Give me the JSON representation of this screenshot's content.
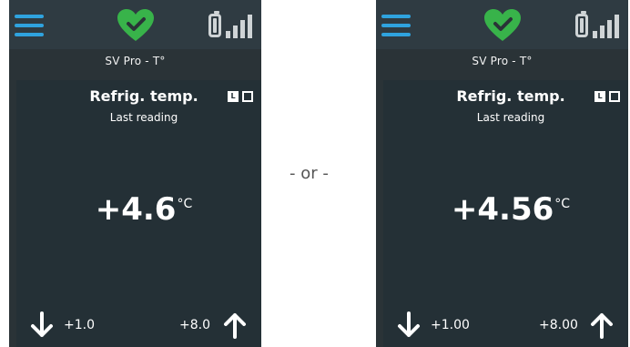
{
  "colors": {
    "background": "#ffffff",
    "device_background": "#2a3337",
    "topbar": "#2f3b42",
    "menu_blue": "#2fa3df",
    "heart_green": "#38b34a",
    "heart_check": "#2a3337",
    "icon_gray": "#cfd4d6",
    "text": "#ffffff"
  },
  "separator": "- or -",
  "devices": [
    {
      "device_name": "SV Pro - T°",
      "measure_title": "Refrig. temp.",
      "measure_subtitle": "Last reading",
      "lh_toggle_label": "L",
      "reading_value": "+4.6",
      "reading_unit": "°C",
      "low_limit": "+1.0",
      "high_limit": "+8.0",
      "icons": [
        "menu-icon",
        "heart-check-icon",
        "battery-icon",
        "signal-icon",
        "arrow-down-icon",
        "arrow-up-icon"
      ]
    },
    {
      "device_name": "SV Pro - T°",
      "measure_title": "Refrig. temp.",
      "measure_subtitle": "Last reading",
      "lh_toggle_label": "L",
      "reading_value": "+4.56",
      "reading_unit": "°C",
      "low_limit": "+1.00",
      "high_limit": "+8.00",
      "icons": [
        "menu-icon",
        "heart-check-icon",
        "battery-icon",
        "signal-icon",
        "arrow-down-icon",
        "arrow-up-icon"
      ]
    }
  ]
}
